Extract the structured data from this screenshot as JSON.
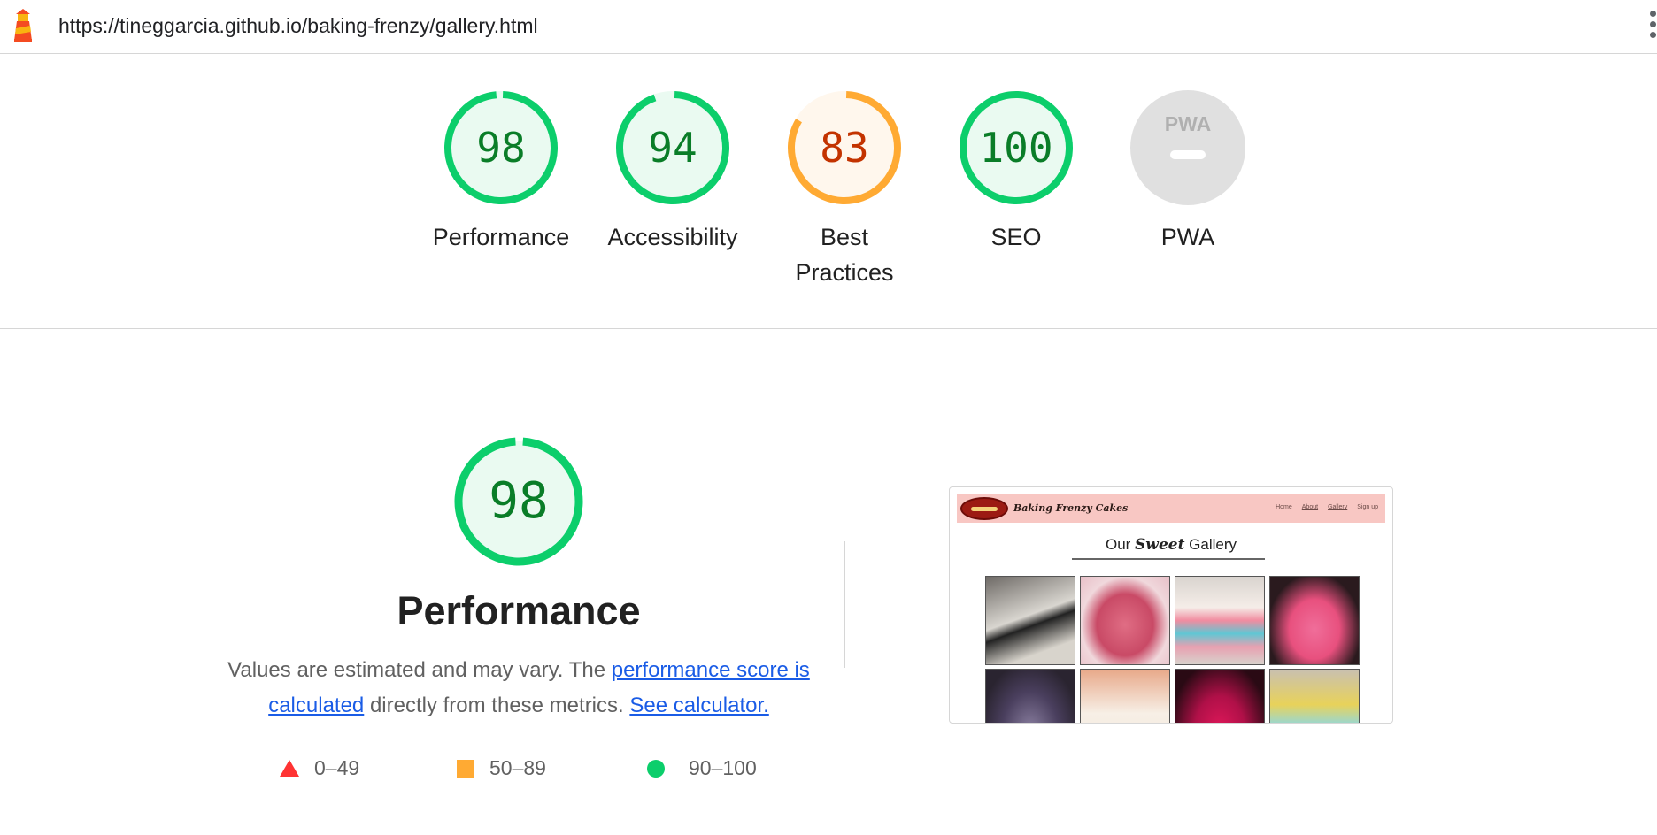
{
  "browser": {
    "url": "https://tineggarcia.github.io/baking-frenzy/gallery.html"
  },
  "summary": {
    "gauges": [
      {
        "label": "Performance",
        "score": "98",
        "level": 98,
        "rating": "pass"
      },
      {
        "label": "Accessibility",
        "score": "94",
        "level": 94,
        "rating": "pass"
      },
      {
        "label": "Best Practices",
        "score": "83",
        "level": 83,
        "rating": "average"
      },
      {
        "label": "SEO",
        "score": "100",
        "level": 100,
        "rating": "pass"
      },
      {
        "label": "PWA",
        "score": "",
        "badge": "PWA",
        "rating": "na"
      }
    ]
  },
  "performance": {
    "score": "98",
    "level": 98,
    "title": "Performance",
    "desc_before": "Values are estimated and may vary. The ",
    "link_score": "performance score is calculated",
    "desc_middle": " directly from these metrics. ",
    "link_calc": "See calculator.",
    "legend": [
      {
        "range": "0–49",
        "shape": "triangle",
        "color": "#ff3333"
      },
      {
        "range": "50–89",
        "shape": "square",
        "color": "#ffaa33"
      },
      {
        "range": "90–100",
        "shape": "circle",
        "color": "#0cce6b"
      }
    ]
  },
  "screenshot": {
    "brand": "Baking Frenzy Cakes",
    "nav": [
      "Home",
      "About",
      "Gallery",
      "Sign up"
    ],
    "heading_before": "Our ",
    "heading_em": "Sweet",
    "heading_after": " Gallery"
  },
  "colors": {
    "pass": "#0cce6b",
    "pass_text": "#0a7d28",
    "pass_fill": "#eafaf1",
    "average": "#ffaa33",
    "average_text": "#c33300",
    "average_fill": "#fff7ed",
    "na_fill": "#e0e0e0",
    "na_text": "#b0b0b0",
    "link": "#1a5ce6"
  }
}
